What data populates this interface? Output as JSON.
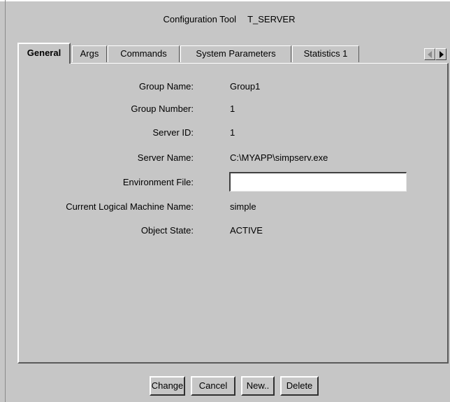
{
  "window": {
    "title": "Configuration Tool",
    "subtitle": "T_SERVER"
  },
  "tabs": [
    {
      "label": "General",
      "active": true
    },
    {
      "label": "Args"
    },
    {
      "label": "Commands"
    },
    {
      "label": "System Parameters"
    },
    {
      "label": "Statistics 1"
    }
  ],
  "tab_scroll_icons": [
    "arrow-left-icon",
    "arrow-right-icon"
  ],
  "fields": {
    "group_name": {
      "label": "Group Name:",
      "value": "Group1"
    },
    "group_number": {
      "label": "Group Number:",
      "value": "1"
    },
    "server_id": {
      "label": "Server ID:",
      "value": "1"
    },
    "server_name": {
      "label": "Server Name:",
      "value": "C:\\MYAPP\\simpserv.exe"
    },
    "environment_file": {
      "label": "Environment File:",
      "value": "",
      "placeholder": ""
    },
    "lmid": {
      "label": "Current Logical Machine Name:",
      "value": "simple"
    },
    "object_state": {
      "label": "Object State:",
      "value": "ACTIVE"
    }
  },
  "buttons": {
    "change": "Change",
    "cancel": "Cancel",
    "new": "New..",
    "delete": "Delete"
  }
}
